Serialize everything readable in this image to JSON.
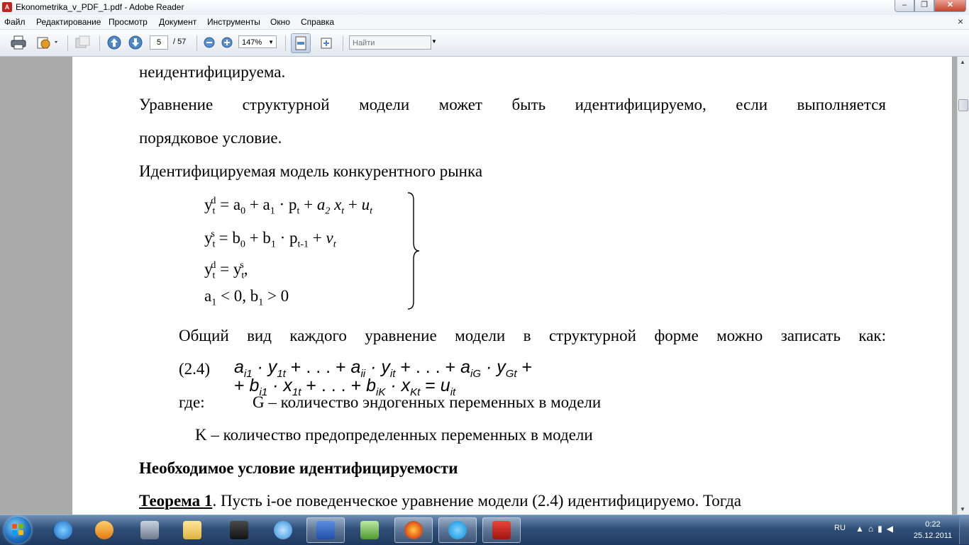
{
  "window": {
    "title": "Ekonometrika_v_PDF_1.pdf - Adobe Reader",
    "app_icon": "adobe-reader-icon"
  },
  "menu": {
    "items": [
      "Файл",
      "Редактирование",
      "Просмотр",
      "Документ",
      "Инструменты",
      "Окно",
      "Справка"
    ],
    "close_glyph": "×"
  },
  "toolbar": {
    "current_page": "5",
    "total_pages": "/ 57",
    "zoom": "147%",
    "find_placeholder": "Найти"
  },
  "document": {
    "line1": "неидентифицируема.",
    "para1_line1": "Уравнение структурной модели может быть идентифицируемо, если выполняется",
    "para1_line2": "порядковое условие.",
    "model_heading": "Идентифицируемая модель конкурентного рынка",
    "general_form": "Общий вид каждого уравнение модели в структурной форме можно записать как:",
    "eq_number": "(2.4)",
    "where_label": "где:",
    "g_def": "G – количество эндогенных переменных в модели",
    "k_def": "K – количество предопределенных переменных в модели",
    "necessary_heading": "Необходимое условие идентифицируемости",
    "theorem_label": "Теорема 1",
    "theorem_text": ". Пусть  i-ое поведенческое уравнение модели (2.4) идентифицируемо. Тогда"
  },
  "taskbar": {
    "language": "RU",
    "time": "0:22",
    "date": "25.12.2011",
    "apps": [
      "internet-explorer-icon",
      "media-player-icon",
      "scanner-icon",
      "folder-icon",
      "movie-maker-icon",
      "sync-icon",
      "word-icon",
      "usb-icon",
      "firefox-icon",
      "skype-icon",
      "adobe-reader-icon"
    ]
  },
  "colors": {
    "accent": "#c8201a",
    "taskbar": "#2f4f78"
  }
}
